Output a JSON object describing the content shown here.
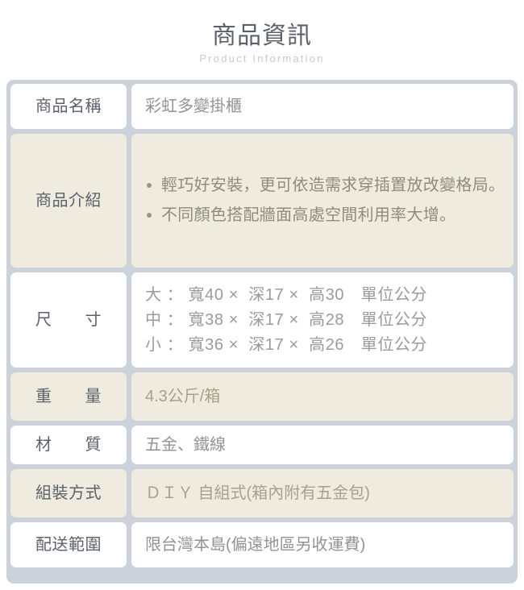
{
  "header": {
    "title": "商品資訊",
    "subtitle": "Product Information"
  },
  "table": {
    "rows": [
      {
        "label": "商品名稱",
        "value": "彩虹多變掛櫃"
      },
      {
        "label": "商品介紹",
        "bullets": [
          "輕巧好安裝，更可依造需求穿插置放改變格局。",
          "不同顏色搭配牆面高處空間利用率大增。"
        ]
      },
      {
        "label": "尺　　寸",
        "lines": [
          "大 ： 寬40 ×  深17 ×  高30　單位公分",
          "中 ： 寬38 ×  深17 ×  高28　單位公分",
          "小 ： 寬36 ×  深17 ×  高26　單位公分"
        ]
      },
      {
        "label": "重　　量",
        "value": "4.3公斤/箱"
      },
      {
        "label": "材　　質",
        "value": "五金、鐵線"
      },
      {
        "label": "組裝方式",
        "value": "ＤＩＹ 自組式(箱內附有五金包)"
      },
      {
        "label": "配送範圍",
        "value": "限台灣本島(偏遠地區另收運費)"
      }
    ]
  },
  "colors": {
    "frame": "#ccd2da",
    "beige_cell": "#efebdf",
    "white_cell": "#ffffff",
    "label_text": "#5b616b",
    "value_text": "#939393",
    "title_text": "#5b616b",
    "subtitle_text": "#c9c9c9"
  }
}
